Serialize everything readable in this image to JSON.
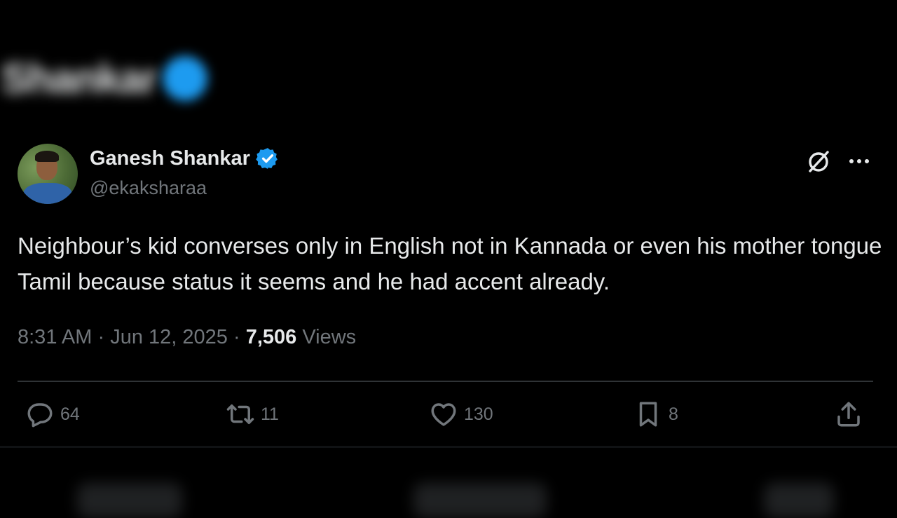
{
  "blurred_header": {
    "name": "Shankar"
  },
  "tweet": {
    "author": {
      "name": "Ganesh Shankar",
      "handle": "@ekaksharaa"
    },
    "text": "Neighbour’s kid converses only in English not in Kannada or even his mother tongue Tamil because status it seems and he had accent already.",
    "time": "8:31 AM",
    "separator": "·",
    "date": "Jun 12, 2025",
    "views_count": "7,506",
    "views_label": "Views",
    "actions": {
      "reply": "64",
      "retweet": "11",
      "like": "130",
      "bookmark": "8"
    }
  },
  "colors": {
    "background": "#000000",
    "text_primary": "#e7e9ea",
    "text_secondary": "#71767b",
    "verified_blue": "#1d9bf0",
    "divider": "#2f3336"
  }
}
